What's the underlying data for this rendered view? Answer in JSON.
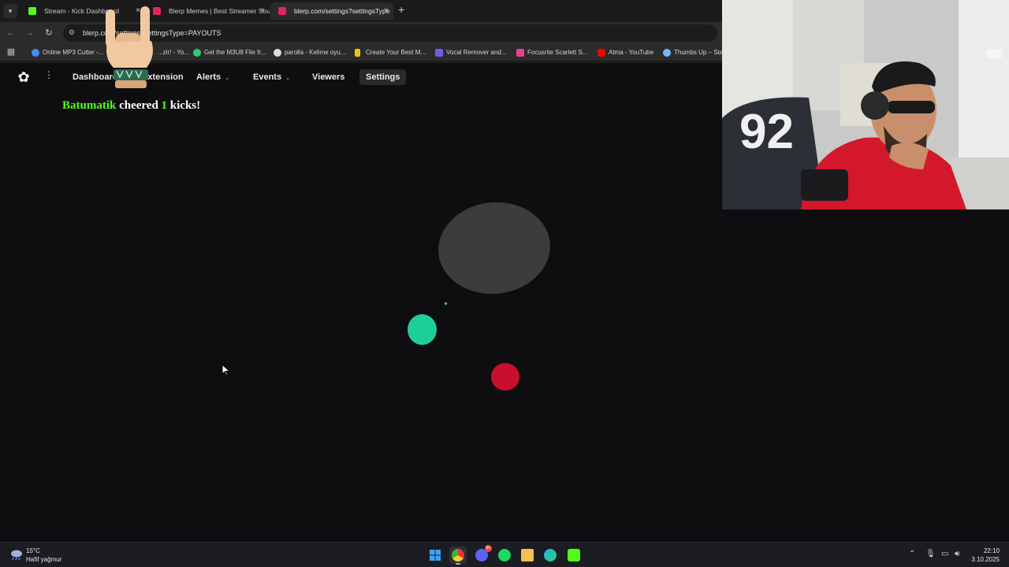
{
  "browser": {
    "tabs": [
      {
        "label": "Stream - Kick Dashboard",
        "favicon_color": "#53fc18",
        "close": "×"
      },
      {
        "label": "Blerp Memes | Best Streamer Sound",
        "favicon_color": "#e0245e",
        "close": "×"
      },
      {
        "label": "blerp.com/settings?settingsType",
        "favicon_color": "#e0245e",
        "close": "×",
        "active": true
      }
    ],
    "new_tab": "+",
    "url": "blerp.com/settings?settingsType=PAYOUTS",
    "bookmarks": [
      {
        "label": "Online MP3 Cutter -...",
        "color": "#4a8cf7"
      },
      {
        "label": "...zir! - Yo...",
        "color": "#e74c3c"
      },
      {
        "label": "Get the M3U8 File fr...",
        "color": "#2ecc71"
      },
      {
        "label": "parolla - Kelime oyu...",
        "color": "#dddddd"
      },
      {
        "label": "Create Your Best M...",
        "color": "#f1c40f"
      },
      {
        "label": "Vocal Remover and...",
        "color": "#6c5ce7"
      },
      {
        "label": "Focusrite Scarlett S...",
        "color": "#e84393"
      },
      {
        "label": "Atma - YouTube",
        "color": "#ff0000"
      },
      {
        "label": "Thumbs Up – Star",
        "color": "#74b9ff"
      }
    ]
  },
  "site_nav": {
    "items": [
      {
        "label": "Dashboard"
      },
      {
        "label": "Extension"
      },
      {
        "label": "Alerts",
        "chevron": "⌄"
      },
      {
        "label": "Events",
        "chevron": "⌄"
      },
      {
        "label": "Viewers"
      },
      {
        "label": "Settings",
        "selected": true
      }
    ],
    "logo_icon": "blerp-logo-icon",
    "kebab": "⋮"
  },
  "alert": {
    "user": "Batumatik",
    "verb": "cheered",
    "amount": "1",
    "unit": "kicks!"
  },
  "taskbar": {
    "weather": {
      "temp": "15°C",
      "condition": "Hafif yağmur"
    },
    "apps": [
      "start",
      "chrome",
      "discord",
      "spotify",
      "file-explorer",
      "edge",
      "kick"
    ],
    "discord_badge": "9+",
    "time": "22:10",
    "date": "3.10.2025"
  },
  "colors": {
    "kick_green": "#53fc18",
    "blob_gray": "#3b3c3e",
    "blob_teal": "#1fcf9a",
    "blob_red": "#c8102e"
  }
}
